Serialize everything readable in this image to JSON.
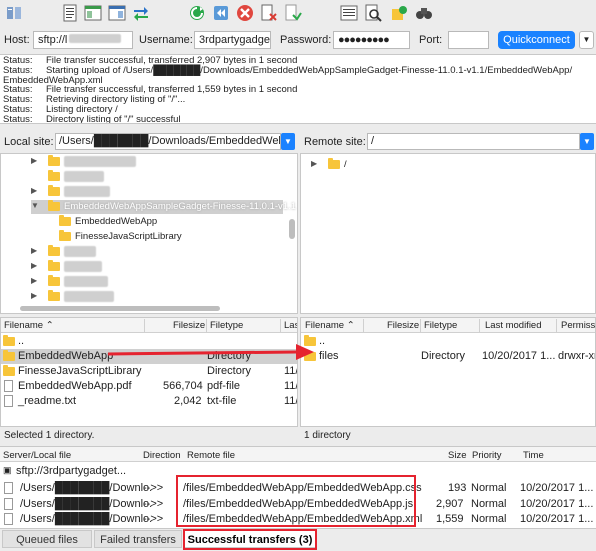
{
  "toolbar": {
    "icons": [
      "site-manager-icon",
      "toggle-log-icon",
      "toggle-local-tree-icon",
      "toggle-remote-tree-icon",
      "toggle-queue-icon",
      "refresh-icon",
      "process-queue-icon",
      "cancel-icon",
      "disconnect-icon",
      "reconnect-icon",
      "directory-comparison-icon",
      "filter-icon",
      "sync-browsing-icon",
      "search-icon"
    ]
  },
  "quickconnect": {
    "host_label": "Host:",
    "host_value": "sftp://l",
    "username_label": "Username:",
    "username_value": "3rdpartygadget",
    "password_label": "Password:",
    "password_value": "●●●●●●●●●",
    "port_label": "Port:",
    "port_value": "",
    "button_label": "Quickconnect"
  },
  "log": [
    {
      "status": "Status:",
      "msg": "File transfer successful, transferred 2,907 bytes in 1 second"
    },
    {
      "status": "Status:",
      "msg": "Starting upload of /Users/███████/Downloads/EmbeddedWebAppSampleGadget-Finesse-11.0.1-v1.1/EmbeddedWebApp/"
    },
    {
      "status": "",
      "msg": "EmbeddedWebApp.xml"
    },
    {
      "status": "Status:",
      "msg": "File transfer successful, transferred 1,559 bytes in 1 second"
    },
    {
      "status": "Status:",
      "msg": "Retrieving directory listing of \"/\"..."
    },
    {
      "status": "Status:",
      "msg": "Listing directory /"
    },
    {
      "status": "Status:",
      "msg": "Directory listing of \"/\" successful"
    }
  ],
  "local": {
    "label": "Local site:",
    "path": "/Users/███████/Downloads/EmbeddedWebAppS",
    "tree": [
      {
        "label": "",
        "expanded": false,
        "blurred": true
      },
      {
        "label": "",
        "expanded": false,
        "blurred": true
      },
      {
        "label": "",
        "expanded": false,
        "blurred": true
      },
      {
        "label": "EmbeddedWebAppSampleGadget-Finesse-11.0.1-v1.1",
        "expanded": true,
        "blurred": true
      },
      {
        "label": "EmbeddedWebApp",
        "expanded": false,
        "blurred": false
      },
      {
        "label": "FinesseJavaScriptLibrary",
        "expanded": false,
        "blurred": false
      },
      {
        "label": "",
        "expanded": false,
        "blurred": true
      },
      {
        "label": "",
        "expanded": false,
        "blurred": true
      },
      {
        "label": "",
        "expanded": false,
        "blurred": true
      },
      {
        "label": "",
        "expanded": false,
        "blurred": true
      }
    ],
    "columns": [
      "Filename",
      "Filesize",
      "Filetype",
      "Las"
    ],
    "files": [
      {
        "name": "..",
        "size": "",
        "type": "",
        "date": "",
        "kind": "folder"
      },
      {
        "name": "EmbeddedWebApp",
        "size": "",
        "type": "Directory",
        "date": "",
        "kind": "folder"
      },
      {
        "name": "FinesseJavaScriptLibrary",
        "size": "",
        "type": "Directory",
        "date": "11/",
        "kind": "folder"
      },
      {
        "name": "EmbeddedWebApp.pdf",
        "size": "566,704",
        "type": "pdf-file",
        "date": "11/",
        "kind": "file"
      },
      {
        "name": "_readme.txt",
        "size": "2,042",
        "type": "txt-file",
        "date": "11/",
        "kind": "file"
      }
    ],
    "status": "Selected 1 directory."
  },
  "remote": {
    "label": "Remote site:",
    "path": "/",
    "tree_root": "/",
    "columns": [
      "Filename",
      "Filesize",
      "Filetype",
      "Last modified",
      "Permissi"
    ],
    "files": [
      {
        "name": "..",
        "size": "",
        "type": "",
        "modified": "",
        "perms": "",
        "kind": "folder"
      },
      {
        "name": "files",
        "size": "",
        "type": "Directory",
        "modified": "10/20/2017 1...",
        "perms": "drwxr-xr",
        "kind": "folder"
      }
    ],
    "status": "1 directory"
  },
  "queue": {
    "columns": [
      "Server/Local file",
      "Direction",
      "Remote file",
      "Size",
      "Priority",
      "Time"
    ],
    "server": "sftp://3rdpartygadget...",
    "rows": [
      {
        "local": "/Users/███████/Downlo.",
        "direction": "-->>",
        "remote": "/files/EmbeddedWebApp/EmbeddedWebApp.css",
        "size": "193",
        "priority": "Normal",
        "time": "10/20/2017 1..."
      },
      {
        "local": "/Users/███████/Downlo.",
        "direction": "-->>",
        "remote": "/files/EmbeddedWebApp/EmbeddedWebApp.js",
        "size": "2,907",
        "priority": "Normal",
        "time": "10/20/2017 1..."
      },
      {
        "local": "/Users/███████/Downlo.",
        "direction": "-->>",
        "remote": "/files/EmbeddedWebApp/EmbeddedWebApp.xml",
        "size": "1,559",
        "priority": "Normal",
        "time": "10/20/2017 1..."
      }
    ]
  },
  "tabs": [
    {
      "label": "Queued files",
      "active": false
    },
    {
      "label": "Failed transfers",
      "active": false
    },
    {
      "label": "Successful transfers (3)",
      "active": true
    }
  ],
  "colors": {
    "accent": "#1a82ff",
    "annotation": "#e5232f",
    "folder": "#f7c53a"
  }
}
